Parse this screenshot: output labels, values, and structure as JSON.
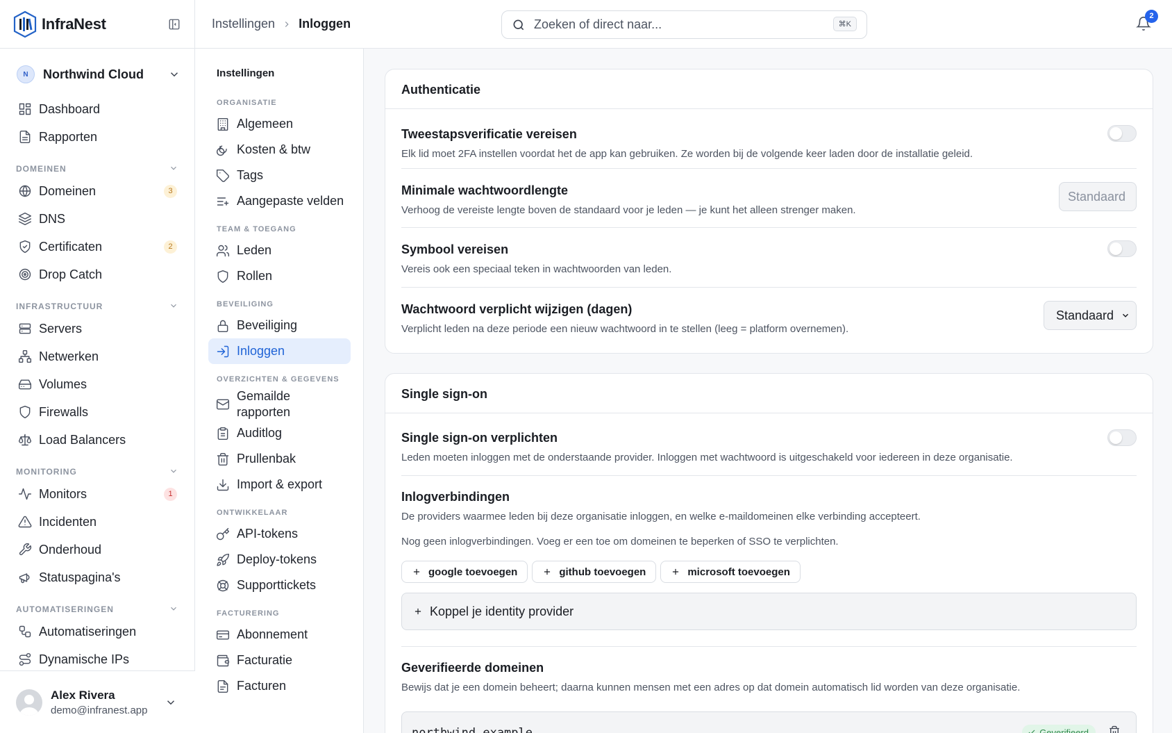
{
  "app": {
    "name": "InfraNest"
  },
  "breadcrumb": {
    "parent": "Instellingen",
    "current": "Inloggen"
  },
  "search": {
    "placeholder": "Zoeken of direct naar...",
    "shortcut": "⌘K"
  },
  "notifications": {
    "count": "2"
  },
  "org": {
    "initial": "N",
    "name": "Northwind Cloud"
  },
  "sidebar": {
    "top": [
      {
        "label": "Dashboard",
        "icon": "dashboard-icon"
      },
      {
        "label": "Rapporten",
        "icon": "document-icon"
      }
    ],
    "domains": {
      "heading": "DOMEINEN",
      "items": [
        {
          "label": "Domeinen",
          "icon": "globe-icon",
          "count": "3"
        },
        {
          "label": "DNS",
          "icon": "layers-icon"
        },
        {
          "label": "Certificaten",
          "icon": "shield-check-icon",
          "count": "2"
        },
        {
          "label": "Drop Catch",
          "icon": "target-icon"
        }
      ]
    },
    "infra": {
      "heading": "INFRASTRUCTUUR",
      "items": [
        {
          "label": "Servers",
          "icon": "server-icon"
        },
        {
          "label": "Netwerken",
          "icon": "network-icon"
        },
        {
          "label": "Volumes",
          "icon": "drive-icon"
        },
        {
          "label": "Firewalls",
          "icon": "shield-icon"
        },
        {
          "label": "Load Balancers",
          "icon": "scale-icon"
        }
      ]
    },
    "monitoring": {
      "heading": "MONITORING",
      "items": [
        {
          "label": "Monitors",
          "icon": "activity-icon",
          "count": "1"
        },
        {
          "label": "Incidenten",
          "icon": "warning-icon"
        },
        {
          "label": "Onderhoud",
          "icon": "wrench-icon"
        },
        {
          "label": "Statuspagina's",
          "icon": "megaphone-icon"
        }
      ]
    },
    "automation": {
      "heading": "AUTOMATISERINGEN",
      "items": [
        {
          "label": "Automatiseringen",
          "icon": "workflow-icon"
        },
        {
          "label": "Dynamische IPs",
          "icon": "route-icon"
        }
      ]
    }
  },
  "user": {
    "name": "Alex Rivera",
    "email": "demo@infranest.app"
  },
  "settings_nav": {
    "title": "Instellingen",
    "org": {
      "heading": "ORGANISATIE",
      "items": [
        "Algemeen",
        "Kosten & btw",
        "Tags",
        "Aangepaste velden"
      ]
    },
    "team": {
      "heading": "TEAM & TOEGANG",
      "items": [
        "Leden",
        "Rollen"
      ]
    },
    "security": {
      "heading": "BEVEILIGING",
      "items": [
        "Beveiliging",
        "Inloggen"
      ]
    },
    "overviews": {
      "heading": "OVERZICHTEN & GEGEVENS",
      "items": [
        "Gemailde rapporten",
        "Auditlog",
        "Prullenbak",
        "Import & export"
      ]
    },
    "dev": {
      "heading": "ONTWIKKELAAR",
      "items": [
        "API-tokens",
        "Deploy-tokens",
        "Supporttickets"
      ]
    },
    "billing": {
      "heading": "FACTURERING",
      "items": [
        "Abonnement",
        "Facturatie",
        "Facturen"
      ]
    }
  },
  "auth_card": {
    "title": "Authenticatie",
    "rows": [
      {
        "title": "Tweestapsverificatie vereisen",
        "desc": "Elk lid moet 2FA instellen voordat het de app kan gebruiken. Ze worden bij de volgende keer laden door de installatie geleid.",
        "enabled": false
      },
      {
        "title": "Minimale wachtwoordlengte",
        "desc": "Verhoog de vereiste lengte boven de standaard voor je leden — je kunt het alleen strenger maken.",
        "placeholder": "Standaard"
      },
      {
        "title": "Symbool vereisen",
        "desc": "Vereis ook een speciaal teken in wachtwoorden van leden.",
        "enabled": false
      },
      {
        "title": "Wachtwoord verplicht wijzigen (dagen)",
        "desc": "Verplicht leden na deze periode een nieuw wachtwoord in te stellen (leeg = platform overnemen).",
        "selected": "Standaard"
      }
    ]
  },
  "sso_card": {
    "title": "Single sign-on",
    "require": {
      "title": "Single sign-on verplichten",
      "desc": "Leden moeten inloggen met de onderstaande provider. Inloggen met wachtwoord is uitgeschakeld voor iedereen in deze organisatie.",
      "enabled": false
    },
    "connections": {
      "title": "Inlogverbindingen",
      "desc": "De providers waarmee leden bij deze organisatie inloggen, en welke e-maildomeinen elke verbinding accepteert.",
      "empty": "Nog geen inlogverbindingen. Voeg er een toe om domeinen te beperken of SSO te verplichten.",
      "buttons": [
        "google toevoegen",
        "github toevoegen",
        "microsoft toevoegen"
      ],
      "idp_button": "Koppel je identity provider"
    },
    "verified": {
      "title": "Geverifieerde domeinen",
      "desc": "Bewijs dat je een domein beheert; daarna kunnen mensen met een adres op dat domein automatisch lid worden van deze organisatie.",
      "domain": "northwind.example",
      "status": "Geverifieerd"
    }
  }
}
